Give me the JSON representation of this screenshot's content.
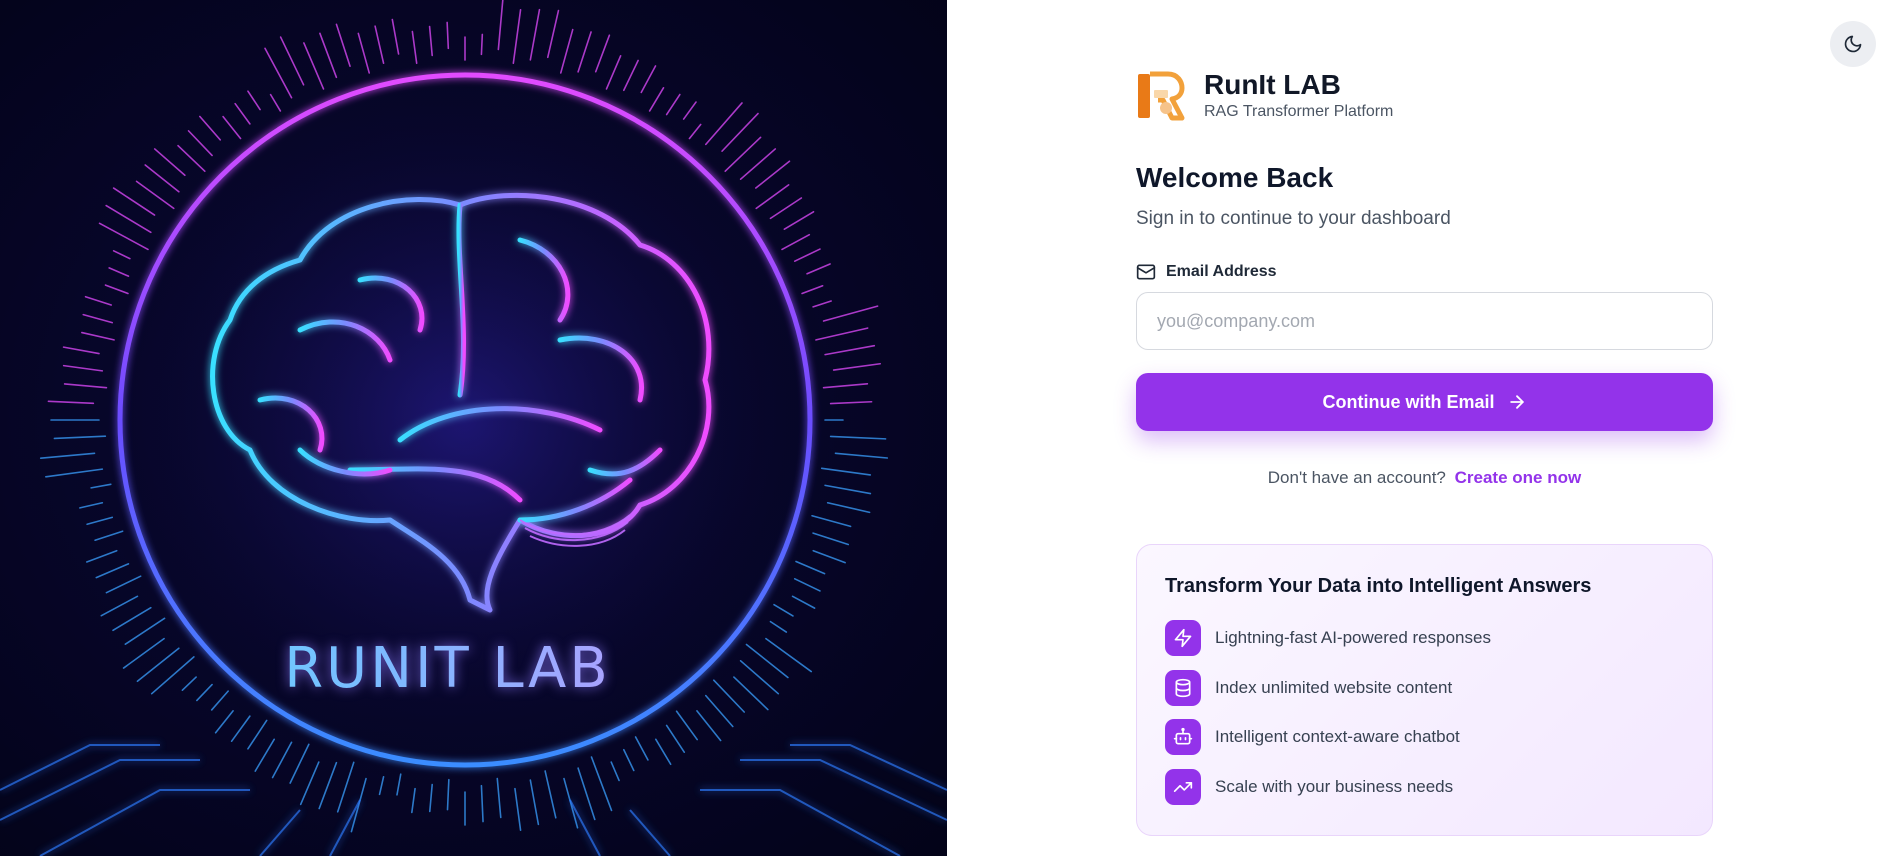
{
  "hero": {
    "title": "RUNIT LAB",
    "colors": {
      "cyan": "#39e0ff",
      "magenta": "#e24bff",
      "blue": "#4c5bff",
      "background": "#07062a"
    }
  },
  "theme_toggle": {
    "icon": "moon-icon"
  },
  "brand": {
    "name": "RunIt LAB",
    "tagline": "RAG Transformer Platform",
    "logo_icon": "runit-logo-icon"
  },
  "login": {
    "heading": "Welcome Back",
    "subheading": "Sign in to continue to your dashboard",
    "email_label": "Email Address",
    "email_icon": "mail-icon",
    "email_placeholder": "you@company.com",
    "email_value": "",
    "submit_label": "Continue with Email",
    "submit_icon": "arrow-right-icon",
    "signup_prompt": "Don't have an account?",
    "signup_link": "Create one now"
  },
  "features": {
    "title": "Transform Your Data into Intelligent Answers",
    "items": [
      {
        "icon": "lightning-icon",
        "text": "Lightning-fast AI-powered responses"
      },
      {
        "icon": "database-icon",
        "text": "Index unlimited website content"
      },
      {
        "icon": "bot-icon",
        "text": "Intelligent context-aware chatbot"
      },
      {
        "icon": "trending-up-icon",
        "text": "Scale with your business needs"
      }
    ]
  },
  "colors": {
    "accent": "#9333ea",
    "text_dark": "#0f172a",
    "text_muted": "#4b5563",
    "input_border": "#d6d9df"
  }
}
